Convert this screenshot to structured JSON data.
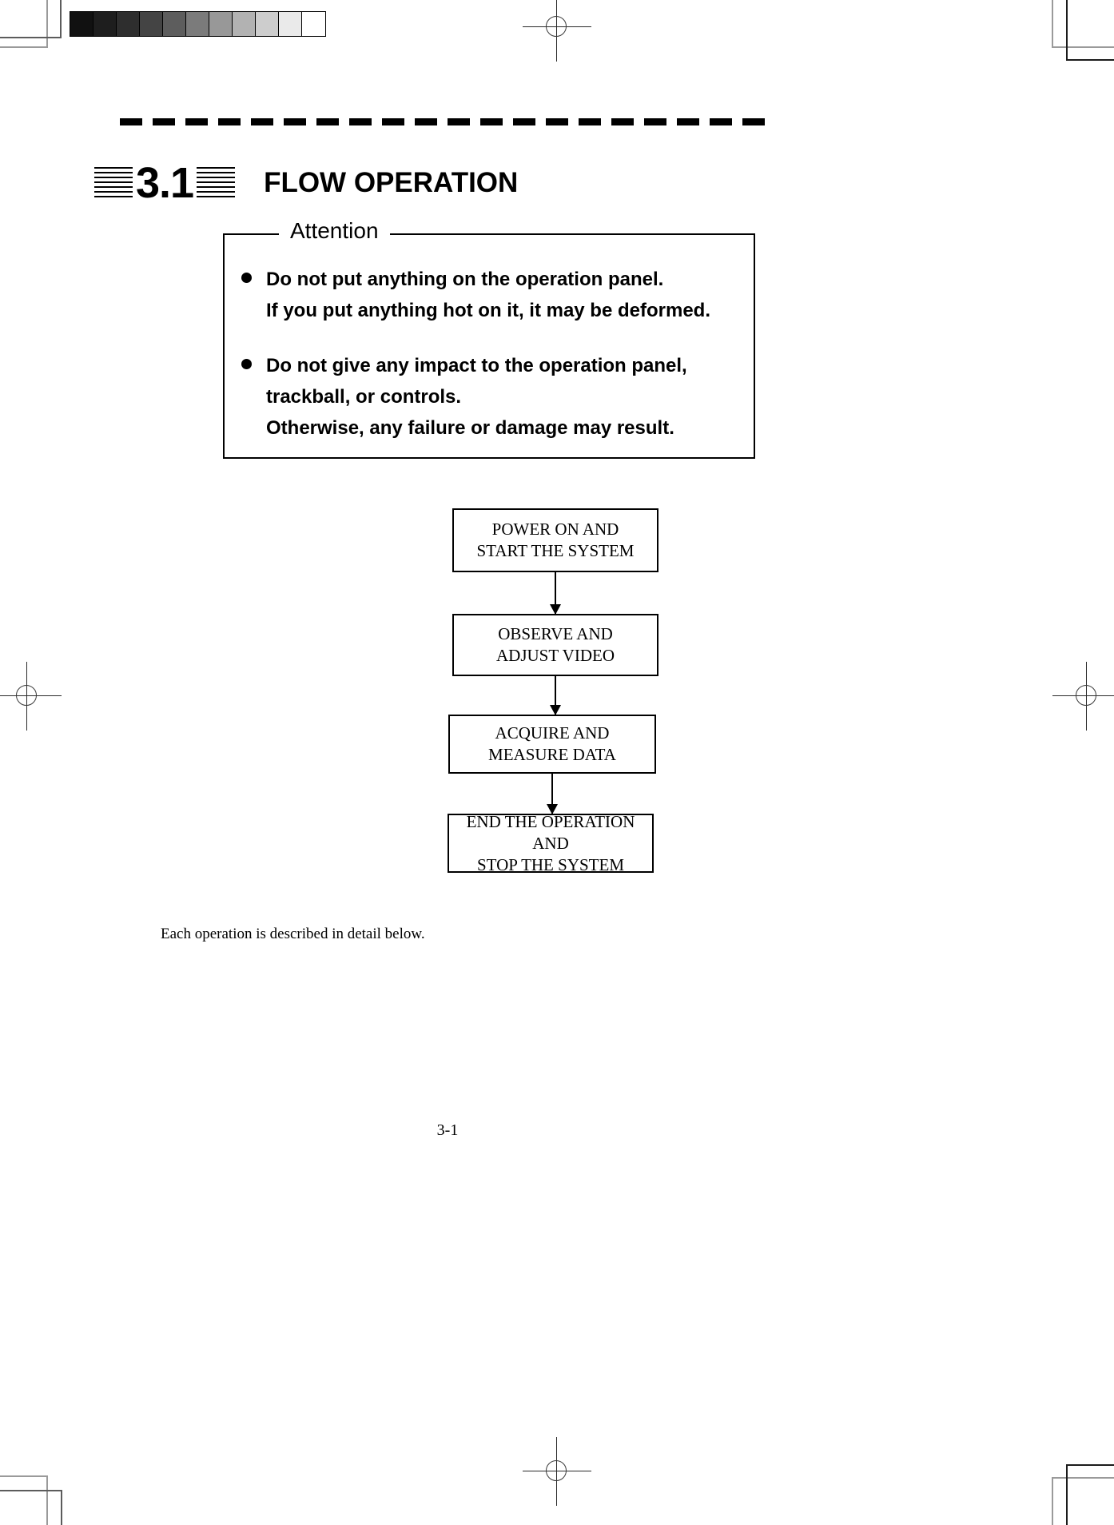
{
  "page": {
    "section_number": "3.1",
    "section_title": "FLOW OPERATION",
    "footer_page_number": "3-1",
    "closing_note": "Each operation is described in detail below."
  },
  "attention": {
    "legend": "Attention",
    "items": [
      {
        "lines": [
          "Do not put anything on the operation panel.",
          "If you put anything hot on it, it may be deformed."
        ]
      },
      {
        "lines": [
          "Do not give any impact to the operation panel,",
          "trackball, or controls.",
          "Otherwise, any failure or damage may result."
        ]
      }
    ]
  },
  "chart_data": {
    "type": "diagram",
    "title": "FLOW OPERATION",
    "orientation": "vertical",
    "connector": "arrow-down",
    "nodes": [
      {
        "id": "step1",
        "label": "POWER ON AND\nSTART THE SYSTEM",
        "shape": "rectangle"
      },
      {
        "id": "step2",
        "label": "OBSERVE AND\nADJUST VIDEO",
        "shape": "rectangle"
      },
      {
        "id": "step3",
        "label": "ACQUIRE AND\nMEASURE DATA",
        "shape": "rectangle"
      },
      {
        "id": "step4",
        "label": "END THE OPERATION AND\nSTOP THE SYSTEM",
        "shape": "rectangle"
      }
    ],
    "edges": [
      {
        "from": "step1",
        "to": "step2"
      },
      {
        "from": "step2",
        "to": "step3"
      },
      {
        "from": "step3",
        "to": "step4"
      }
    ]
  },
  "scan_artifacts": {
    "grayscale_strip": [
      "#111111",
      "#1e1e1e",
      "#2e2e2e",
      "#444444",
      "#5d5d5d",
      "#7b7b7b",
      "#989898",
      "#b2b2b2",
      "#cdcdcd",
      "#eaeaea",
      "#ffffff"
    ],
    "registration_mark_name": "registration-crosshair"
  }
}
